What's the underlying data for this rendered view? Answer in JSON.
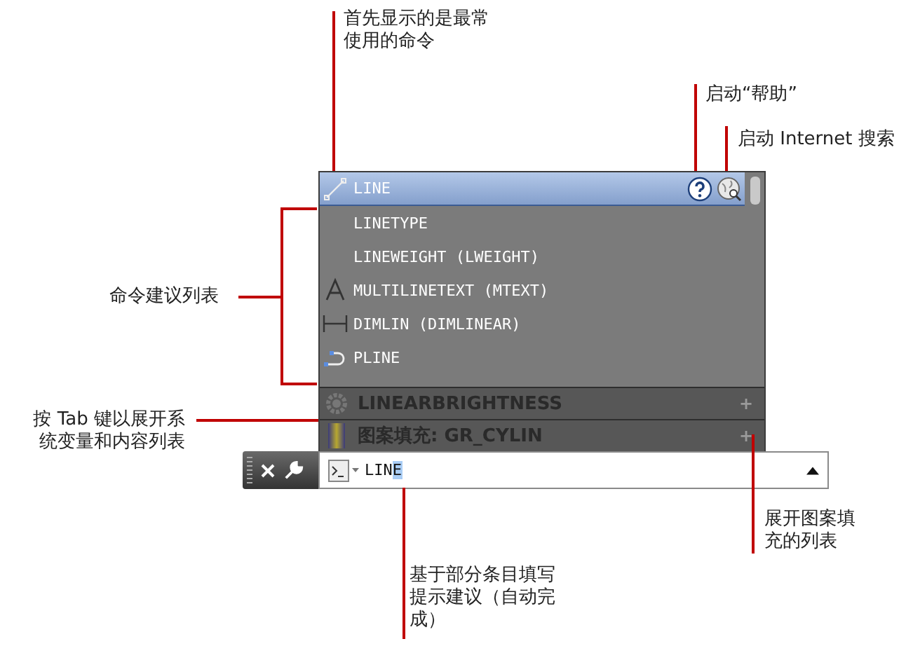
{
  "suggestions": [
    {
      "label": "LINE",
      "kind": "line",
      "selected": true
    },
    {
      "label": "LINETYPE",
      "kind": "plain",
      "selected": false
    },
    {
      "label": "LINEWEIGHT (LWEIGHT)",
      "kind": "plain",
      "selected": false
    },
    {
      "label": "MULTILINETEXT (MTEXT)",
      "kind": "text",
      "selected": false
    },
    {
      "label": "DIMLIN (DIMLINEAR)",
      "kind": "dimension",
      "selected": false
    },
    {
      "label": "PLINE",
      "kind": "polyline",
      "selected": false
    }
  ],
  "categories": [
    {
      "label": "LINEARBRIGHTNESS",
      "kind": "variable",
      "expand": "+"
    },
    {
      "label": "图案填充: GR_CYLIN",
      "kind": "hatch",
      "expand": "+"
    }
  ],
  "command_line": {
    "typed": "LIN",
    "completion": "E"
  },
  "annotations": [
    {
      "text": "首先显示的是最常使用的命令"
    },
    {
      "text": "启动“帮助”"
    },
    {
      "text": "启动 Internet 搜索"
    },
    {
      "text": "命令建议列表"
    },
    {
      "text": "按 Tab 键以展开系统变量和内容列表"
    },
    {
      "text": "展开图案填充的列表"
    },
    {
      "text": "基于部分条目填写提示建议（自动完成）"
    }
  ]
}
